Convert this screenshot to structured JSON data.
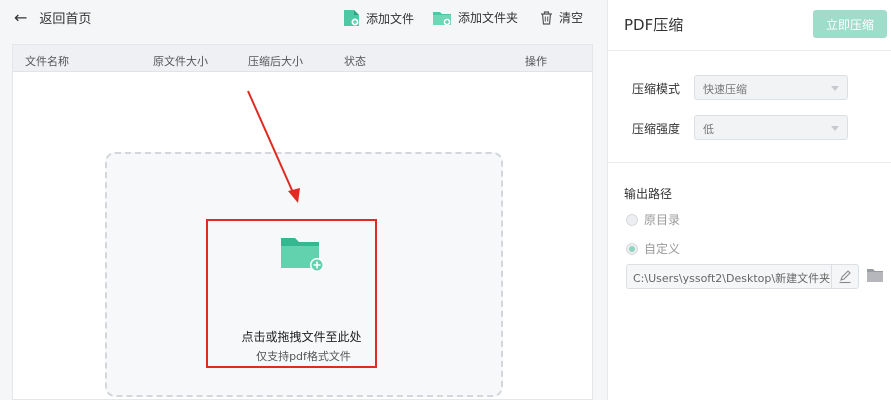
{
  "toolbar": {
    "back_label": "返回首页",
    "add_file_label": "添加文件",
    "add_folder_label": "添加文件夹",
    "clear_label": "清空"
  },
  "table": {
    "columns": [
      "文件名称",
      "原文件大小",
      "压缩后大小",
      "状态",
      "操作"
    ]
  },
  "dropzone": {
    "title": "点击或拖拽文件至此处",
    "subtitle": "仅支持pdf格式文件"
  },
  "panel": {
    "title": "PDF压缩",
    "compress_button": "立即压缩",
    "mode_label": "压缩模式",
    "mode_value": "快速压缩",
    "strength_label": "压缩强度",
    "strength_value": "低",
    "output_label": "输出路径",
    "option_original": "原目录",
    "option_custom": "自定义",
    "path_value": "C:\\Users\\yssoft2\\Desktop\\新建文件夹"
  },
  "colors": {
    "accent": "#4ec8a4",
    "accent_disabled": "#9fdcc9",
    "highlight_red": "#e02a22"
  },
  "icons": [
    "back-arrow-icon",
    "add-file-icon",
    "add-folder-icon",
    "trash-icon",
    "folder-plus-icon",
    "edit-icon",
    "folder-icon"
  ]
}
